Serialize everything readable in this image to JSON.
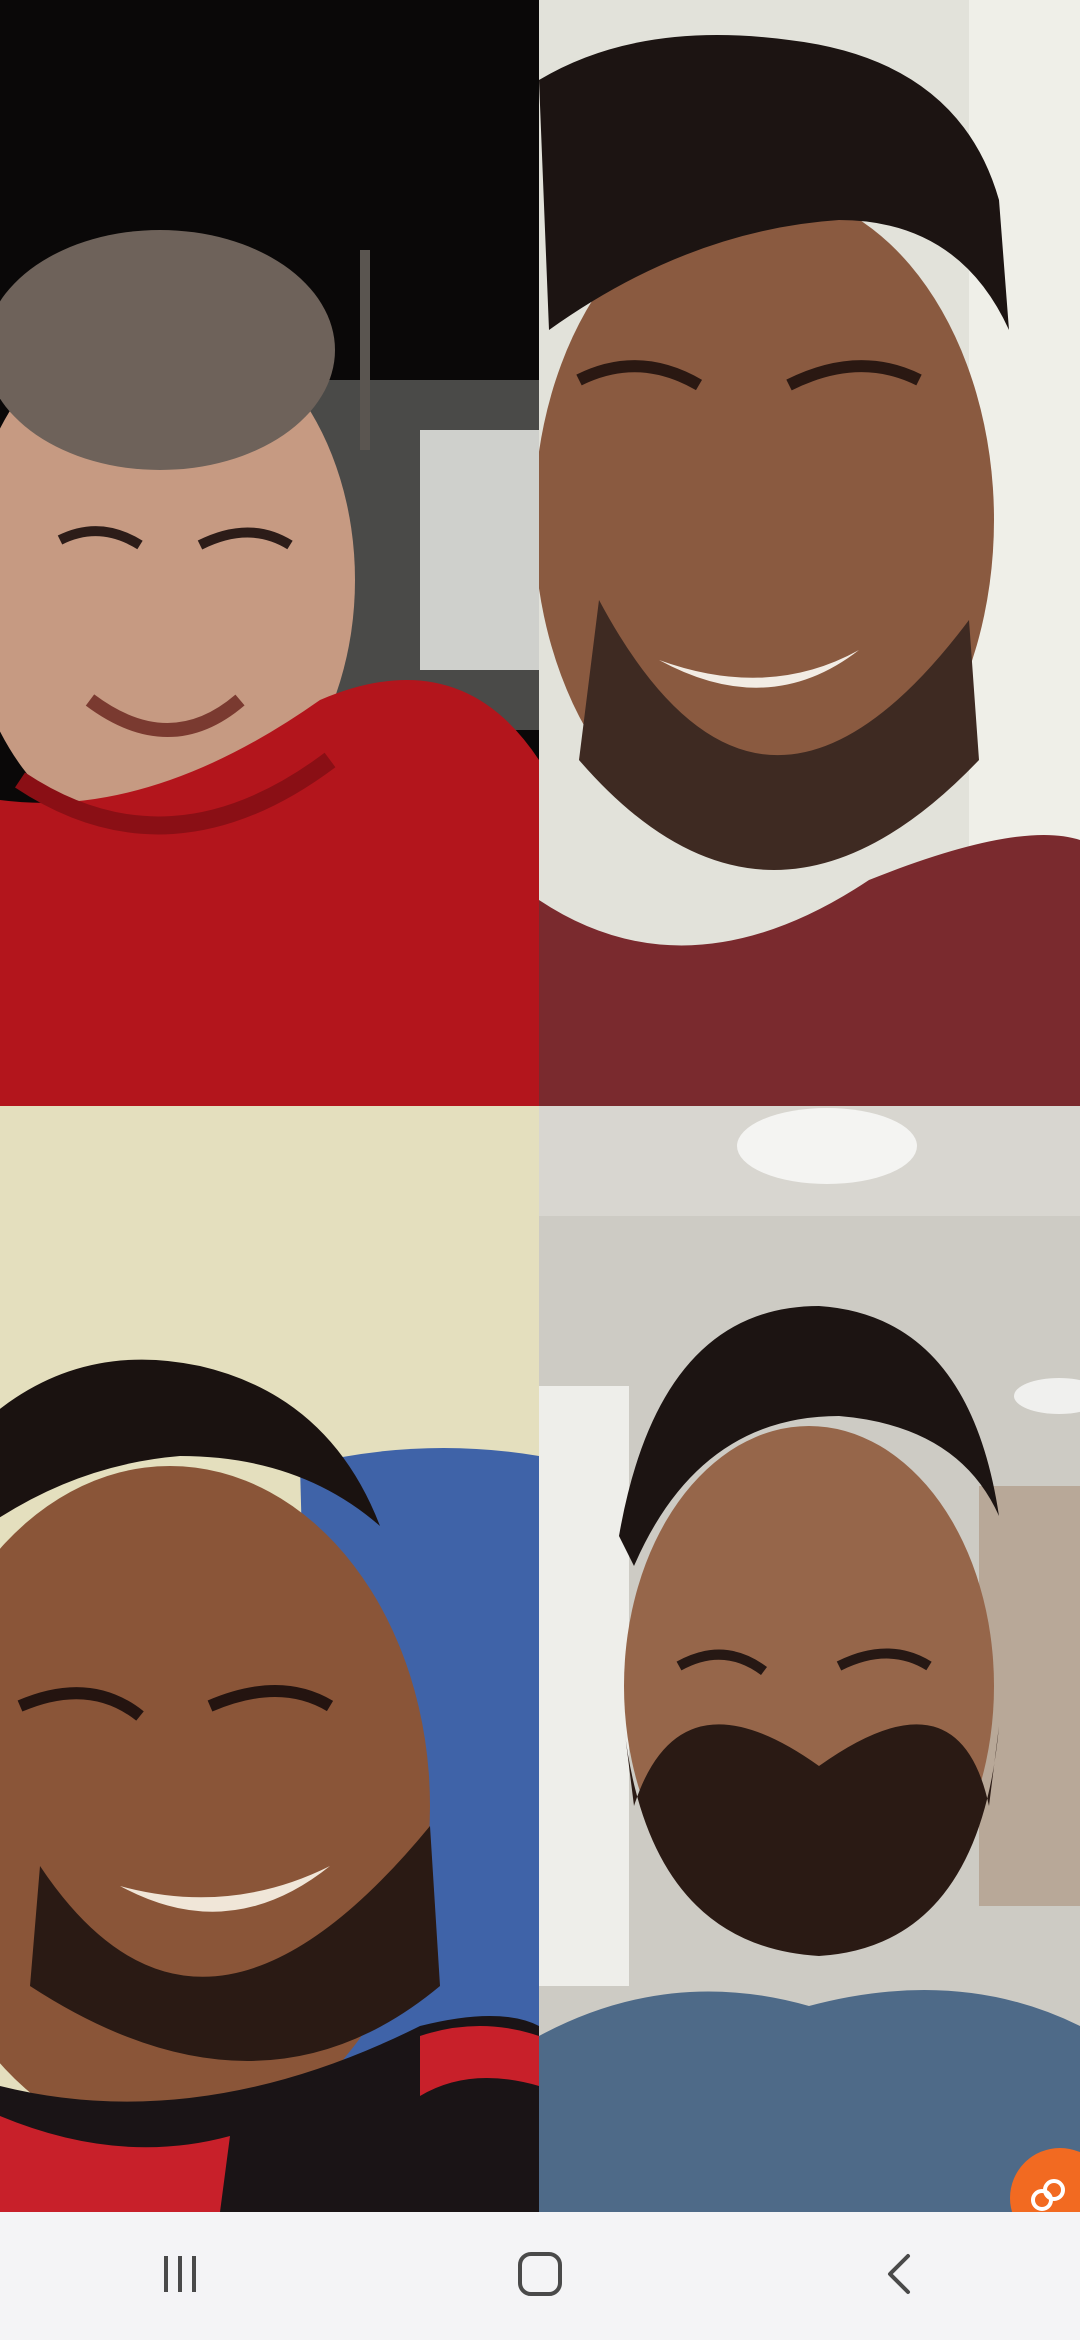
{
  "call": {
    "participants": [
      {
        "position": "top-left"
      },
      {
        "position": "top-right"
      },
      {
        "position": "bottom-left"
      },
      {
        "position": "bottom-right"
      }
    ]
  },
  "floating_button": {
    "icon": "link-icon",
    "color": "#f26a21"
  },
  "navigation_bar": {
    "background": "#f4f4f6",
    "buttons": [
      {
        "icon": "recents-icon"
      },
      {
        "icon": "home-icon"
      },
      {
        "icon": "back-icon"
      }
    ]
  }
}
